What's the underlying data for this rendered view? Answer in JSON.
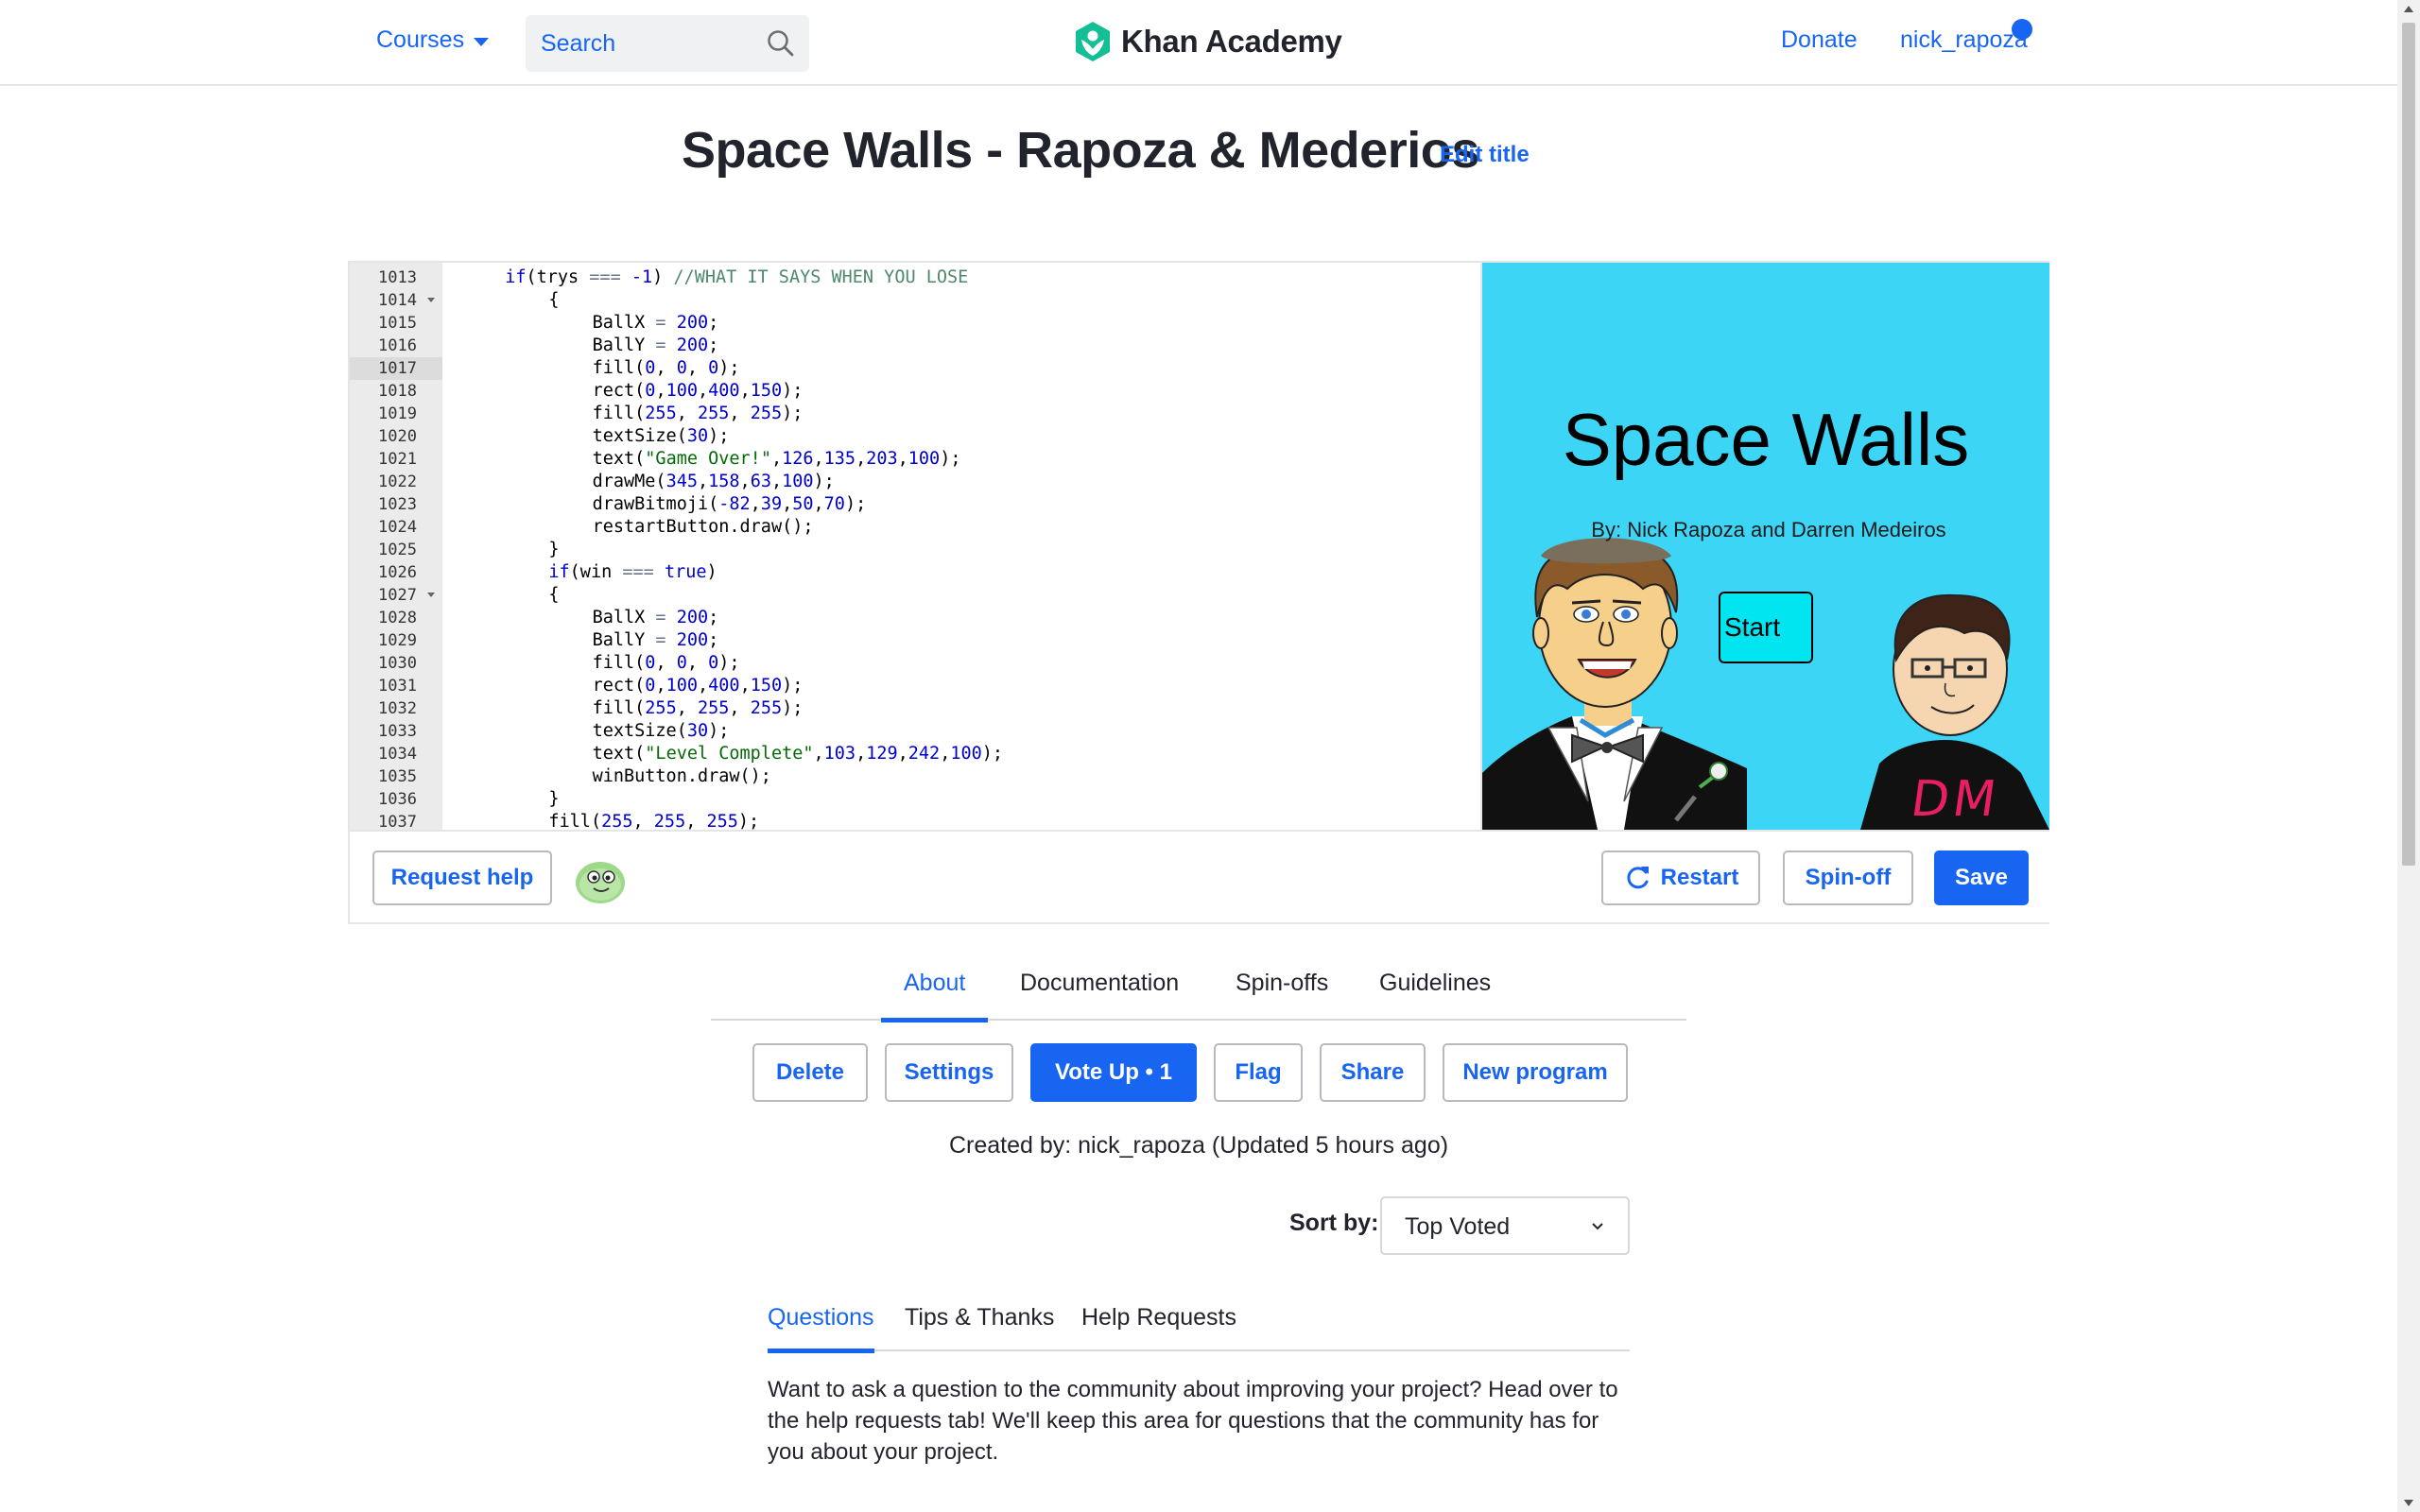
{
  "nav": {
    "courses_label": "Courses",
    "search_placeholder": "Search",
    "logo_text": "Khan Academy",
    "donate_label": "Donate",
    "username": "nick_rapoza"
  },
  "project": {
    "title": "Space Walls - Rapoza & Mederios",
    "edit_title_label": "Edit title"
  },
  "editor": {
    "active_line": "1017",
    "lines": [
      {
        "n": "1013",
        "fold": false
      },
      {
        "n": "1014",
        "fold": true
      },
      {
        "n": "1015",
        "fold": false
      },
      {
        "n": "1016",
        "fold": false
      },
      {
        "n": "1017",
        "fold": false
      },
      {
        "n": "1018",
        "fold": false
      },
      {
        "n": "1019",
        "fold": false
      },
      {
        "n": "1020",
        "fold": false
      },
      {
        "n": "1021",
        "fold": false
      },
      {
        "n": "1022",
        "fold": false
      },
      {
        "n": "1023",
        "fold": false
      },
      {
        "n": "1024",
        "fold": false
      },
      {
        "n": "1025",
        "fold": false
      },
      {
        "n": "1026",
        "fold": false
      },
      {
        "n": "1027",
        "fold": true
      },
      {
        "n": "1028",
        "fold": false
      },
      {
        "n": "1029",
        "fold": false
      },
      {
        "n": "1030",
        "fold": false
      },
      {
        "n": "1031",
        "fold": false
      },
      {
        "n": "1032",
        "fold": false
      },
      {
        "n": "1033",
        "fold": false
      },
      {
        "n": "1034",
        "fold": false
      },
      {
        "n": "1035",
        "fold": false
      },
      {
        "n": "1036",
        "fold": false
      },
      {
        "n": "1037",
        "fold": false
      }
    ],
    "code": [
      {
        "indent": 4,
        "tokens": [
          [
            "kw",
            "if"
          ],
          [
            "",
            "(trys "
          ],
          [
            "op",
            "==="
          ],
          [
            "",
            " "
          ],
          [
            "num",
            "-1"
          ],
          [
            "",
            ") "
          ],
          [
            "cmt",
            "//WHAT IT SAYS WHEN YOU LOSE"
          ]
        ]
      },
      {
        "indent": 8,
        "tokens": [
          [
            "",
            "{"
          ]
        ]
      },
      {
        "indent": 12,
        "tokens": [
          [
            "",
            "BallX "
          ],
          [
            "op",
            "="
          ],
          [
            "",
            " "
          ],
          [
            "num",
            "200"
          ],
          [
            "",
            ";"
          ]
        ]
      },
      {
        "indent": 12,
        "tokens": [
          [
            "",
            "BallY "
          ],
          [
            "op",
            "="
          ],
          [
            "",
            " "
          ],
          [
            "num",
            "200"
          ],
          [
            "",
            ";"
          ]
        ]
      },
      {
        "indent": 12,
        "tokens": [
          [
            "",
            "fill("
          ],
          [
            "num",
            "0"
          ],
          [
            "",
            ", "
          ],
          [
            "num",
            "0"
          ],
          [
            "",
            ", "
          ],
          [
            "num",
            "0"
          ],
          [
            "",
            ");"
          ]
        ]
      },
      {
        "indent": 12,
        "tokens": [
          [
            "",
            "rect("
          ],
          [
            "num",
            "0"
          ],
          [
            "",
            ","
          ],
          [
            "num",
            "100"
          ],
          [
            "",
            ","
          ],
          [
            "num",
            "400"
          ],
          [
            "",
            ","
          ],
          [
            "num",
            "150"
          ],
          [
            "",
            ");"
          ]
        ]
      },
      {
        "indent": 12,
        "tokens": [
          [
            "",
            "fill("
          ],
          [
            "num",
            "255"
          ],
          [
            "",
            ", "
          ],
          [
            "num",
            "255"
          ],
          [
            "",
            ", "
          ],
          [
            "num",
            "255"
          ],
          [
            "",
            ");"
          ]
        ]
      },
      {
        "indent": 12,
        "tokens": [
          [
            "",
            "textSize("
          ],
          [
            "num",
            "30"
          ],
          [
            "",
            ");"
          ]
        ]
      },
      {
        "indent": 12,
        "tokens": [
          [
            "",
            "text("
          ],
          [
            "str",
            "\"Game Over!\""
          ],
          [
            "",
            ","
          ],
          [
            "num",
            "126"
          ],
          [
            "",
            ","
          ],
          [
            "num",
            "135"
          ],
          [
            "",
            ","
          ],
          [
            "num",
            "203"
          ],
          [
            "",
            ","
          ],
          [
            "num",
            "100"
          ],
          [
            "",
            ");"
          ]
        ]
      },
      {
        "indent": 12,
        "tokens": [
          [
            "",
            "drawMe("
          ],
          [
            "num",
            "345"
          ],
          [
            "",
            ","
          ],
          [
            "num",
            "158"
          ],
          [
            "",
            ","
          ],
          [
            "num",
            "63"
          ],
          [
            "",
            ","
          ],
          [
            "num",
            "100"
          ],
          [
            "",
            ");"
          ]
        ]
      },
      {
        "indent": 12,
        "tokens": [
          [
            "",
            "drawBitmoji("
          ],
          [
            "num",
            "-82"
          ],
          [
            "",
            ","
          ],
          [
            "num",
            "39"
          ],
          [
            "",
            ","
          ],
          [
            "num",
            "50"
          ],
          [
            "",
            ","
          ],
          [
            "num",
            "70"
          ],
          [
            "",
            ");"
          ]
        ]
      },
      {
        "indent": 12,
        "tokens": [
          [
            "",
            "restartButton.draw();"
          ]
        ]
      },
      {
        "indent": 8,
        "tokens": [
          [
            "",
            "}"
          ]
        ]
      },
      {
        "indent": 8,
        "tokens": [
          [
            "kw",
            "if"
          ],
          [
            "",
            "(win "
          ],
          [
            "op",
            "==="
          ],
          [
            "",
            " "
          ],
          [
            "kw",
            "true"
          ],
          [
            "",
            ")"
          ]
        ]
      },
      {
        "indent": 8,
        "tokens": [
          [
            "",
            "{"
          ]
        ]
      },
      {
        "indent": 12,
        "tokens": [
          [
            "",
            "BallX "
          ],
          [
            "op",
            "="
          ],
          [
            "",
            " "
          ],
          [
            "num",
            "200"
          ],
          [
            "",
            ";"
          ]
        ]
      },
      {
        "indent": 12,
        "tokens": [
          [
            "",
            "BallY "
          ],
          [
            "op",
            "="
          ],
          [
            "",
            " "
          ],
          [
            "num",
            "200"
          ],
          [
            "",
            ";"
          ]
        ]
      },
      {
        "indent": 12,
        "tokens": [
          [
            "",
            "fill("
          ],
          [
            "num",
            "0"
          ],
          [
            "",
            ", "
          ],
          [
            "num",
            "0"
          ],
          [
            "",
            ", "
          ],
          [
            "num",
            "0"
          ],
          [
            "",
            ");"
          ]
        ]
      },
      {
        "indent": 12,
        "tokens": [
          [
            "",
            "rect("
          ],
          [
            "num",
            "0"
          ],
          [
            "",
            ","
          ],
          [
            "num",
            "100"
          ],
          [
            "",
            ","
          ],
          [
            "num",
            "400"
          ],
          [
            "",
            ","
          ],
          [
            "num",
            "150"
          ],
          [
            "",
            ");"
          ]
        ]
      },
      {
        "indent": 12,
        "tokens": [
          [
            "",
            "fill("
          ],
          [
            "num",
            "255"
          ],
          [
            "",
            ", "
          ],
          [
            "num",
            "255"
          ],
          [
            "",
            ", "
          ],
          [
            "num",
            "255"
          ],
          [
            "",
            ");"
          ]
        ]
      },
      {
        "indent": 12,
        "tokens": [
          [
            "",
            "textSize("
          ],
          [
            "num",
            "30"
          ],
          [
            "",
            ");"
          ]
        ]
      },
      {
        "indent": 12,
        "tokens": [
          [
            "",
            "text("
          ],
          [
            "str",
            "\"Level Complete\""
          ],
          [
            "",
            ","
          ],
          [
            "num",
            "103"
          ],
          [
            "",
            ","
          ],
          [
            "num",
            "129"
          ],
          [
            "",
            ","
          ],
          [
            "num",
            "242"
          ],
          [
            "",
            ","
          ],
          [
            "num",
            "100"
          ],
          [
            "",
            ");"
          ]
        ]
      },
      {
        "indent": 12,
        "tokens": [
          [
            "",
            "winButton.draw();"
          ]
        ]
      },
      {
        "indent": 8,
        "tokens": [
          [
            "",
            "}"
          ]
        ]
      },
      {
        "indent": 8,
        "tokens": [
          [
            "",
            "fill("
          ],
          [
            "num",
            "255"
          ],
          [
            "",
            ", "
          ],
          [
            "num",
            "255"
          ],
          [
            "",
            ", "
          ],
          [
            "num",
            "255"
          ],
          [
            "",
            ");"
          ]
        ]
      }
    ],
    "canvas": {
      "title": "Space Walls",
      "subtitle": "By: Nick Rapoza and Darren Medeiros",
      "start_label": "Start",
      "shirt_text": "DM",
      "background_color": "#3dd5f5"
    },
    "footer": {
      "request_help_label": "Request help",
      "restart_label": "Restart",
      "spinoff_label": "Spin-off",
      "save_label": "Save"
    }
  },
  "tabs": {
    "items": [
      "About",
      "Documentation",
      "Spin-offs",
      "Guidelines"
    ],
    "active": "About"
  },
  "actions": {
    "delete_label": "Delete",
    "settings_label": "Settings",
    "voteup_label": "Vote Up • 1",
    "flag_label": "Flag",
    "share_label": "Share",
    "new_program_label": "New program"
  },
  "created_by": "Created by: nick_rapoza (Updated 5 hours ago)",
  "sort": {
    "label": "Sort by:",
    "selected": "Top Voted"
  },
  "community_tabs": {
    "items": [
      "Questions",
      "Tips & Thanks",
      "Help Requests"
    ],
    "active": "Questions"
  },
  "community_text": "Want to ask a question to the community about improving your project? Head over to the help requests tab! We'll keep this area for questions that the community has for you about your project.",
  "colors": {
    "accent": "#1865f2",
    "logo_green": "#14bf96",
    "text": "#21242c"
  }
}
